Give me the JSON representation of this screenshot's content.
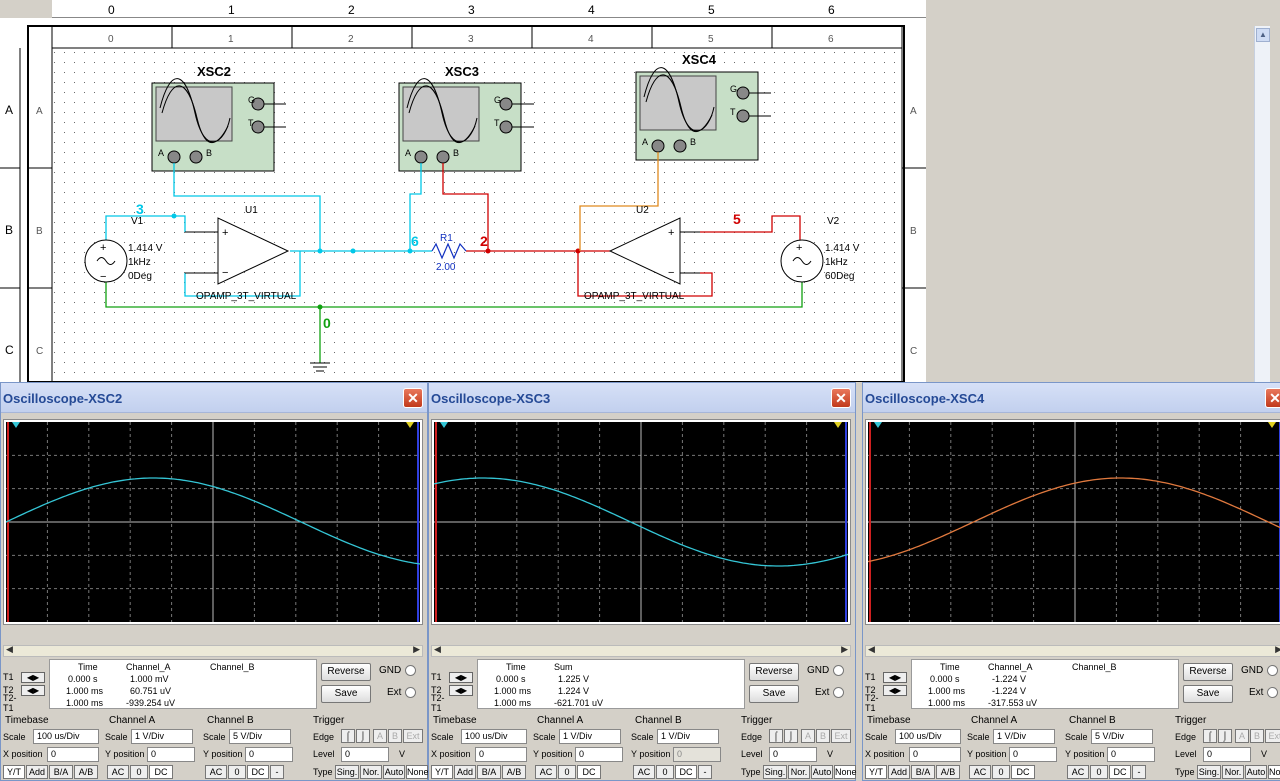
{
  "ruler": {
    "labels": [
      "0",
      "1",
      "2",
      "3",
      "4",
      "5",
      "6"
    ]
  },
  "schematic": {
    "instruments": [
      "XSC2",
      "XSC3",
      "XSC4"
    ],
    "pin_labels": {
      "g": "G",
      "t": "T",
      "a": "A",
      "b": "B"
    },
    "nodes": {
      "n3": "3",
      "n6": "6",
      "n2": "2",
      "n5": "5",
      "n0": "0"
    },
    "v1": {
      "name": "V1",
      "amp": "1.414 V",
      "freq": "1kHz",
      "phase": "0Deg"
    },
    "v2": {
      "name": "V2",
      "amp": "1.414 V",
      "freq": "1kHz",
      "phase": "60Deg"
    },
    "u1": {
      "name": "U1",
      "model": "OPAMP_3T_VIRTUAL"
    },
    "u2": {
      "name": "U2",
      "model": "OPAMP_3T_VIRTUAL"
    },
    "r1": {
      "name": "R1",
      "value": "2.00"
    },
    "row_labels": [
      "A",
      "B",
      "C"
    ]
  },
  "common": {
    "time_hdr": "Time",
    "t1": "T1",
    "t2": "T2",
    "t2t1": "T2-T1",
    "reverse": "Reverse",
    "save": "Save",
    "gnd": "GND",
    "ext": "Ext",
    "timebase": "Timebase",
    "channel_a": "Channel A",
    "channel_b": "Channel B",
    "trigger": "Trigger",
    "scale": "Scale",
    "x_position": "X position",
    "y_position": "Y position",
    "edge": "Edge",
    "level": "Level",
    "type": "Type",
    "yt": "Y/T",
    "add": "Add",
    "ba": "B/A",
    "ab": "A/B",
    "ac": "AC",
    "zero": "0",
    "dc": "DC",
    "minus": "-",
    "sing": "Sing.",
    "nor": "Nor.",
    "auto": "Auto",
    "none": "None",
    "unit_v": "V",
    "trig_a": "A",
    "trig_b": "B",
    "trig_ext": "Ext"
  },
  "oscilloscopes": [
    {
      "title": "Oscilloscope-XSC2",
      "col1": "Channel_A",
      "col2": "Channel_B",
      "t1": {
        "time": "0.000 s",
        "c1": "1.000 mV",
        "c2": ""
      },
      "t2": {
        "time": "1.000 ms",
        "c1": "60.751 uV",
        "c2": ""
      },
      "dt": {
        "time": "1.000 ms",
        "c1": "-939.254 uV",
        "c2": ""
      },
      "timebase_scale": "100 us/Div",
      "x_pos": "0",
      "cha_scale": "1  V/Div",
      "cha_ypos": "0",
      "chb_scale": "5  V/Div",
      "chb_ypos": "0",
      "level": "0",
      "trace_color": "#35c6d6"
    },
    {
      "title": "Oscilloscope-XSC3",
      "col1": "Sum",
      "col2": "",
      "t1": {
        "time": "0.000 s",
        "c1": "1.225 V",
        "c2": ""
      },
      "t2": {
        "time": "1.000 ms",
        "c1": "1.224 V",
        "c2": ""
      },
      "dt": {
        "time": "1.000 ms",
        "c1": "-621.701 uV",
        "c2": ""
      },
      "timebase_scale": "100 us/Div",
      "x_pos": "0",
      "cha_scale": "1  V/Div",
      "cha_ypos": "0",
      "chb_scale": "1  V/Div",
      "chb_ypos": "0",
      "level": "0",
      "trace_color": "#35c6d6"
    },
    {
      "title": "Oscilloscope-XSC4",
      "col1": "Channel_A",
      "col2": "Channel_B",
      "t1": {
        "time": "0.000 s",
        "c1": "-1.224 V",
        "c2": ""
      },
      "t2": {
        "time": "1.000 ms",
        "c1": "-1.224 V",
        "c2": ""
      },
      "dt": {
        "time": "1.000 ms",
        "c1": "-317.553 uV",
        "c2": ""
      },
      "timebase_scale": "100 us/Div",
      "x_pos": "0",
      "cha_scale": "1  V/Div",
      "cha_ypos": "0",
      "chb_scale": "5  V/Div",
      "chb_ypos": "0",
      "level": "0",
      "trace_color": "#e0793e"
    }
  ]
}
